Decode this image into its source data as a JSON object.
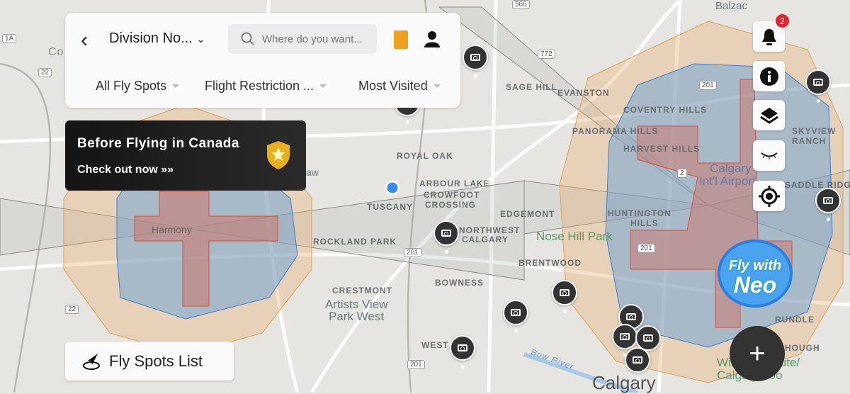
{
  "header": {
    "region": "Division No...",
    "search_placeholder": "Where do you want...",
    "filters": [
      {
        "label": "All Fly Spots"
      },
      {
        "label": "Flight Restriction ..."
      },
      {
        "label": "Most Visited"
      }
    ]
  },
  "banner": {
    "title": "Before Flying in Canada",
    "subtitle": "Check out now"
  },
  "side_buttons": {
    "notification_count": "2"
  },
  "promo": {
    "line1": "Fly with",
    "line2": "Neo"
  },
  "fly_spots_list": "Fly Spots List",
  "colors": {
    "restricted_red": "#e04a3a",
    "authorization_blue": "#5aa0e0",
    "warning_orange": "#e8a040",
    "badge": "#e0262e"
  },
  "map_labels": [
    "Co",
    "SAGE HILL",
    "EVANSTON",
    "COVENTRY HILLS",
    "PANORAMA HILLS",
    "HARVEST HILLS",
    "ROYAL OAK",
    "ARBOUR LAKE",
    "CROWFOOT",
    "CROSSING",
    "TUSCANY",
    "EDGEMONT",
    "NORTHWEST",
    "CALGARY",
    "Nose Hill Park",
    "HUNTINGTON",
    "HILLS",
    "ROCKLAND PARK",
    "BRENTWOOD",
    "BOWNESS",
    "CRESTMONT",
    "Artists View",
    "Park West",
    "WEST",
    "Bow River",
    "Calgary",
    "Harmony",
    "Calgary",
    "Int'l Airport",
    "SKYVIEW",
    "RANCH",
    "SADDLE RIDGE",
    "Balzac",
    "RUNDLE",
    "HOUGH",
    "Wilder Institute/",
    "Calgary Zoo",
    "aw"
  ],
  "highways": [
    "1A",
    "22",
    "566",
    "772",
    "201",
    "2",
    "22",
    "201",
    "201",
    "201"
  ]
}
